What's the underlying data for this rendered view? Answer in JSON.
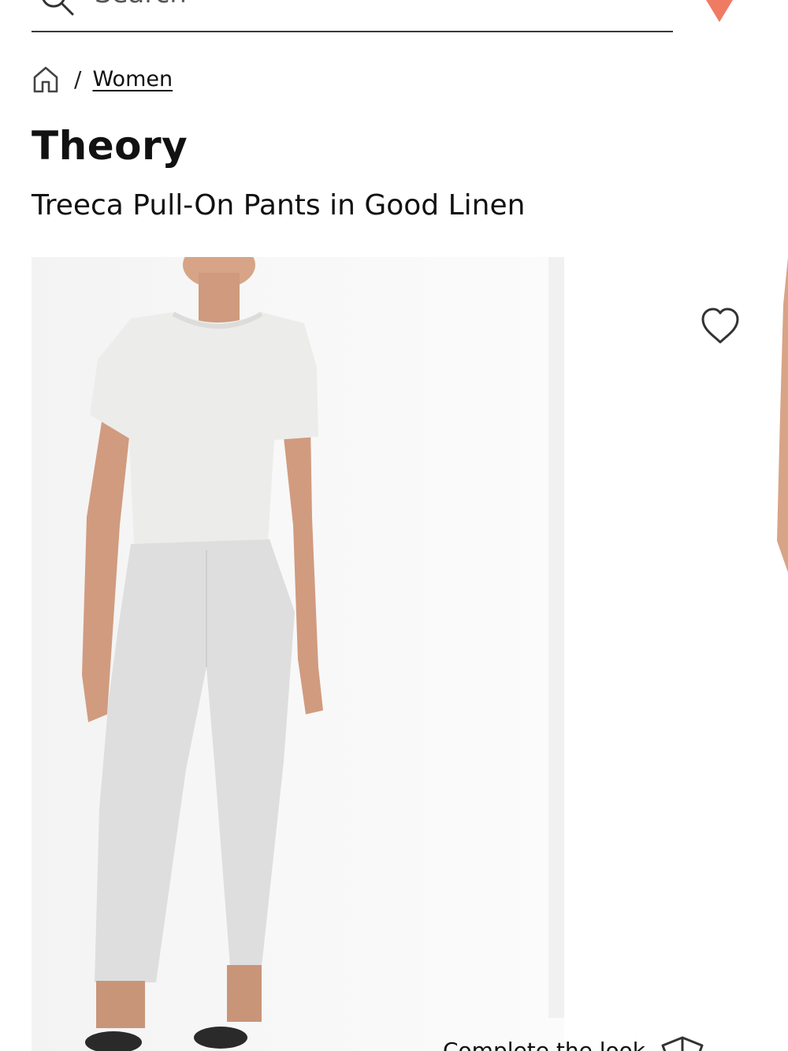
{
  "search": {
    "placeholder": "Search"
  },
  "colors": {
    "brand_accent": "#f07b63",
    "divider": "#3a3a3a"
  },
  "breadcrumb": {
    "separator": "/",
    "items": [
      {
        "label": "Women"
      }
    ]
  },
  "product": {
    "brand": "Theory",
    "name": "Treeca Pull-On Pants in Good Linen"
  },
  "gallery": {
    "complete_look_label": "Complete the look"
  },
  "icons": {
    "search": "search-icon",
    "home": "home-icon",
    "favorite": "heart-icon",
    "complete_look": "hanger-icon",
    "logo": "logo-mark"
  }
}
